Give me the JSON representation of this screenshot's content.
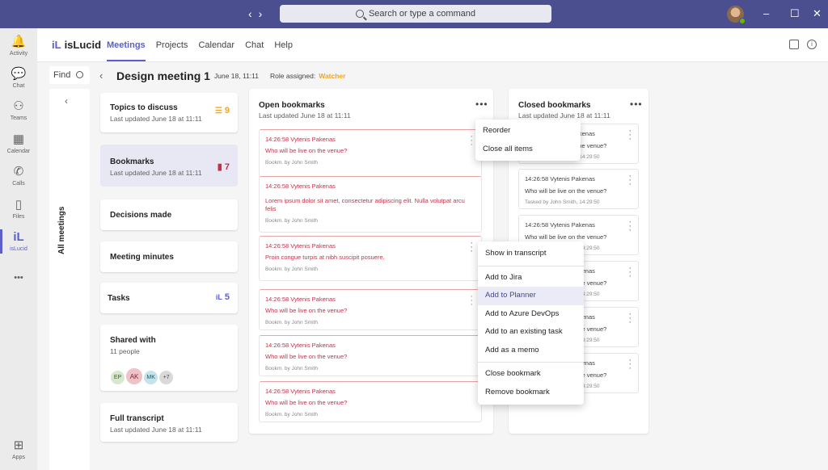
{
  "titlebar": {
    "search_placeholder": "Search or type a command",
    "nav_back": "‹",
    "nav_forward": "›",
    "minimize": "–",
    "maximize": "☐",
    "close": "✕"
  },
  "rail": {
    "items": [
      {
        "label": "Activity",
        "icon": "bell-icon",
        "glyph": "🔔"
      },
      {
        "label": "Chat",
        "icon": "chat-icon",
        "glyph": "💬"
      },
      {
        "label": "Teams",
        "icon": "teams-icon",
        "glyph": "⚇"
      },
      {
        "label": "Calendar",
        "icon": "calendar-icon",
        "glyph": "▦"
      },
      {
        "label": "Calls",
        "icon": "phone-icon",
        "glyph": "✆"
      },
      {
        "label": "Files",
        "icon": "file-icon",
        "glyph": "▯"
      },
      {
        "label": "isLucid",
        "icon": "islucid-icon",
        "glyph": "iL"
      }
    ],
    "more": "•••",
    "apps_label": "Apps",
    "apps_glyph": "⊞"
  },
  "app": {
    "logo_mark": "iL",
    "logo_text": "isLucid",
    "tabs": [
      "Meetings",
      "Projects",
      "Calendar",
      "Chat",
      "Help"
    ],
    "active_tab": "Meetings"
  },
  "subheader": {
    "find_label": "Find",
    "title": "Design meeting 1",
    "date": "June 18, 11:11",
    "role_label": "Role assigned:",
    "role_value": "Watcher",
    "back": "‹"
  },
  "allmeetings": {
    "label": "All meetings",
    "chev": "‹"
  },
  "cards": {
    "topics": {
      "title": "Topics to discuss",
      "sub": "Last updated June 18 at 11:11",
      "count": "9"
    },
    "bookmarks": {
      "title": "Bookmarks",
      "sub": "Last updated June 18 at 11:11",
      "count": "7"
    },
    "decisions": {
      "title": "Decisions made"
    },
    "minutes": {
      "title": "Meeting minutes"
    },
    "tasks": {
      "title": "Tasks",
      "count": "5"
    },
    "shared": {
      "title": "Shared with",
      "sub": "11 people",
      "people": [
        "EP",
        "AK",
        "MK",
        "+7"
      ]
    },
    "transcript": {
      "title": "Full transcript",
      "sub": "Last updated June 18 at 11:11"
    }
  },
  "open_bookmarks": {
    "title": "Open bookmarks",
    "sub": "Last updated June 18 at 11:11",
    "more": "•••",
    "items": [
      {
        "head": "14:26:58 Vytenis Pakenas",
        "text": "Who will be live on the venue?",
        "foot": "Bookm. by John Smith"
      },
      {
        "head": "14:26:58 Vytenis Pakenas",
        "text": "Lorem ipsum dolor sit amet, consectetur adipiscing elit. Nulla volutpat arcu felis",
        "foot": "Bookm. by John Smith"
      },
      {
        "head": "14:26:58 Vytenis Pakenas",
        "text": "Proin congue turpis at nibh suscipit posuere.",
        "foot": "Bookm. by John Smith"
      },
      {
        "head": "14:26:58 Vytenis Pakenas",
        "text": "Who will be live on the venue?",
        "foot": "Bookm. by John Smith"
      },
      {
        "head": "14:26:58 Vytenis Pakenas",
        "text": "Who will be live on the venue?",
        "foot": "Bookm. by John Smith"
      },
      {
        "head": "14:26:58 Vytenis Pakenas",
        "text": "Who will be live on the venue?",
        "foot": "Bookm. by John Smith"
      }
    ]
  },
  "closed_bookmarks": {
    "title": "Closed bookmarks",
    "sub": "Last updated June 18 at 11:11",
    "more": "•••",
    "items": [
      {
        "head": "14:26:58 Vytenis Pakenas",
        "text": "Who will be live on the venue?",
        "foot": "Tasked by John Smith, 14:29:50"
      },
      {
        "head": "14:26:58 Vytenis Pakenas",
        "text": "Who will be live on the venue?",
        "foot": "Tasked by John Smith, 14:29:50"
      },
      {
        "head": "14:26:58 Vytenis Pakenas",
        "text": "Who will be live on the venue?",
        "foot": "Tasked by John Smith, 14:29:50"
      },
      {
        "head": "14:26:58 Vytenis Pakenas",
        "text": "Who will be live on the venue?",
        "foot": "Tasked by John Smith, 14:29:50"
      },
      {
        "head": "14:26:58 Vytenis Pakenas",
        "text": "Who will be live on the venue?",
        "foot": "Tasked by John Smith, 14:29:50"
      },
      {
        "head": "14:26:58 Vytenis Pakenas",
        "text": "Who will be live on the venue?",
        "foot": "Tasked by John Smith, 14:29:50"
      }
    ]
  },
  "menu_top": {
    "items": [
      "Reorder",
      "Close all items"
    ]
  },
  "menu_context": {
    "items": [
      "Show in transcript",
      "Add to Jira",
      "Add to Planner",
      "Add to Azure DevOps",
      "Add to an existing task",
      "Add as a memo",
      "Close bookmark",
      "Remove bookmark"
    ],
    "highlighted": "Add to Planner"
  },
  "colors": {
    "accent": "#5b5fc7",
    "bookmark_red": "#c4314b",
    "watcher": "#f7a51c",
    "titlebar": "#4b4f8f"
  }
}
